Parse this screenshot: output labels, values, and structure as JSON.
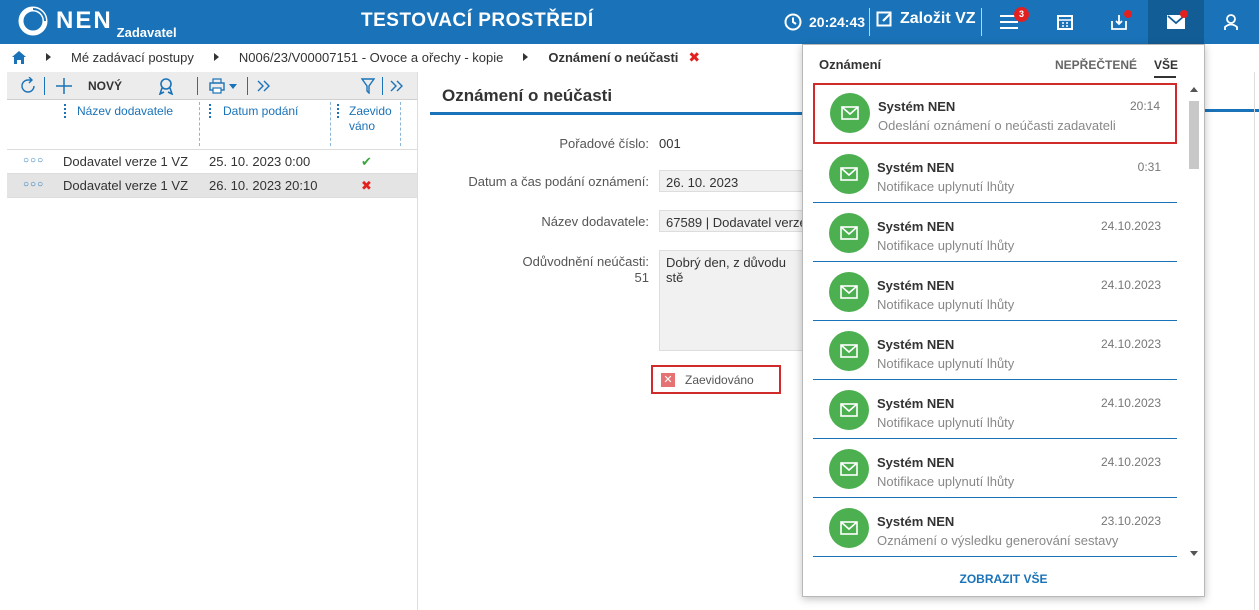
{
  "header": {
    "logo_text": "NEN",
    "logo_sub": "Zadavatel",
    "env_title": "TESTOVACÍ PROSTŘEDÍ",
    "clock_time": "20:24:43",
    "new_vz_label": "Založit VZ",
    "menu_badge": "3"
  },
  "breadcrumb": {
    "items": [
      "Mé zadávací postupy",
      "N006/23/V00007151 - Ovoce a ořechy - kopie",
      "Oznámení o neúčasti"
    ],
    "close": "✖"
  },
  "toolbar": {
    "new_label": "NOVÝ"
  },
  "grid": {
    "columns": [
      "Název dodavatele",
      "Datum podání",
      "Zaevido váno"
    ],
    "rows": [
      {
        "dots": "○○○",
        "name": "Dodavatel verze 1 VZ",
        "date": "25. 10. 2023 0:00",
        "status": "✔"
      },
      {
        "dots": "○○○",
        "name": "Dodavatel verze 1 VZ",
        "date": "26. 10. 2023 20:10",
        "status": "✖"
      }
    ]
  },
  "detail": {
    "title": "Oznámení o neúčasti",
    "fields": {
      "poradove_label": "Pořadové číslo:",
      "poradove_value": "001",
      "datum_label": "Datum a čas podání oznámení:",
      "datum_value": "26. 10. 2023",
      "nazev_label": "Název dodavatele:",
      "nazev_value": "67589 | Dodavatel verze",
      "oduvodneni_label": "Odůvodnění neúčasti:",
      "oduvodneni_count": "51",
      "oduvodneni_value": "Dobrý den, z důvodu stě"
    },
    "zaevidovano_label": "Zaevidováno"
  },
  "notifications": {
    "title": "Oznámení",
    "tab_unread": "NEPŘEČTENÉ",
    "tab_all": "VŠE",
    "show_all": "ZOBRAZIT VŠE",
    "items": [
      {
        "sender": "Systém NEN",
        "time": "20:14",
        "text": "Odeslání oznámení o neúčasti zadavateli"
      },
      {
        "sender": "Systém NEN",
        "time": "0:31",
        "text": "Notifikace uplynutí lhůty"
      },
      {
        "sender": "Systém NEN",
        "time": "24.10.2023",
        "text": "Notifikace uplynutí lhůty"
      },
      {
        "sender": "Systém NEN",
        "time": "24.10.2023",
        "text": "Notifikace uplynutí lhůty"
      },
      {
        "sender": "Systém NEN",
        "time": "24.10.2023",
        "text": "Notifikace uplynutí lhůty"
      },
      {
        "sender": "Systém NEN",
        "time": "24.10.2023",
        "text": "Notifikace uplynutí lhůty"
      },
      {
        "sender": "Systém NEN",
        "time": "24.10.2023",
        "text": "Notifikace uplynutí lhůty"
      },
      {
        "sender": "Systém NEN",
        "time": "23.10.2023",
        "text": "Oznámení o výsledku generování sestavy"
      }
    ]
  },
  "colors": {
    "brand": "#1a73b8",
    "accent_red": "#e32020",
    "success": "#4caf50"
  }
}
